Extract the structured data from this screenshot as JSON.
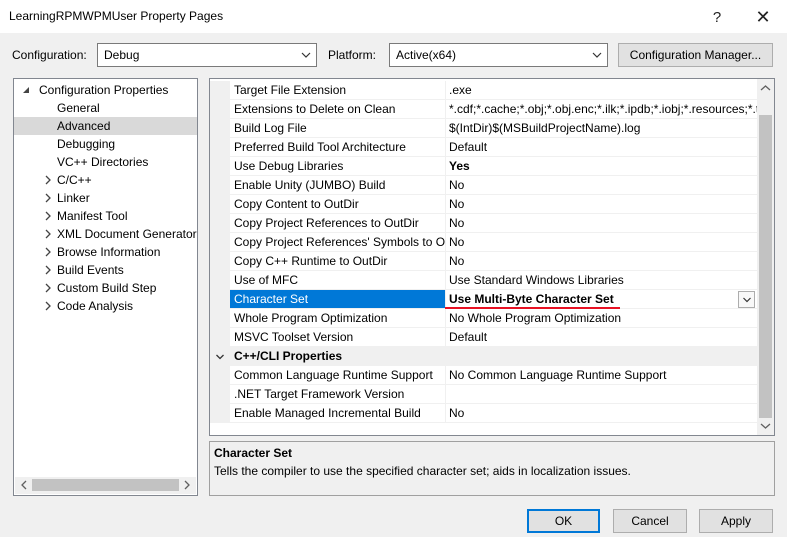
{
  "window": {
    "title": "LearningRPMWPMUser Property Pages",
    "help_glyph": "?",
    "close_glyph": "✕"
  },
  "config_bar": {
    "configuration_label": "Configuration:",
    "configuration_value": "Debug",
    "platform_label": "Platform:",
    "platform_value": "Active(x64)",
    "manager_button": "Configuration Manager..."
  },
  "tree": {
    "root": "Configuration Properties",
    "items": [
      {
        "label": "General",
        "expandable": false
      },
      {
        "label": "Advanced",
        "expandable": false,
        "selected": true
      },
      {
        "label": "Debugging",
        "expandable": false
      },
      {
        "label": "VC++ Directories",
        "expandable": false
      },
      {
        "label": "C/C++",
        "expandable": true
      },
      {
        "label": "Linker",
        "expandable": true
      },
      {
        "label": "Manifest Tool",
        "expandable": true
      },
      {
        "label": "XML Document Generator",
        "expandable": true
      },
      {
        "label": "Browse Information",
        "expandable": true
      },
      {
        "label": "Build Events",
        "expandable": true
      },
      {
        "label": "Custom Build Step",
        "expandable": true
      },
      {
        "label": "Code Analysis",
        "expandable": true
      }
    ]
  },
  "grid": {
    "rows": [
      {
        "name": "Target File Extension",
        "value": ".exe"
      },
      {
        "name": "Extensions to Delete on Clean",
        "value": "*.cdf;*.cache;*.obj;*.obj.enc;*.ilk;*.ipdb;*.iobj;*.resources;*.tlb;*.tli;*.tlh;"
      },
      {
        "name": "Build Log File",
        "value": "$(IntDir)$(MSBuildProjectName).log"
      },
      {
        "name": "Preferred Build Tool Architecture",
        "value": "Default"
      },
      {
        "name": "Use Debug Libraries",
        "value": "Yes",
        "bold": true
      },
      {
        "name": "Enable Unity (JUMBO) Build",
        "value": "No"
      },
      {
        "name": "Copy Content to OutDir",
        "value": "No"
      },
      {
        "name": "Copy Project References to OutDir",
        "value": "No"
      },
      {
        "name": "Copy Project References' Symbols to OutDir",
        "value": "No"
      },
      {
        "name": "Copy C++ Runtime to OutDir",
        "value": "No"
      },
      {
        "name": "Use of MFC",
        "value": "Use Standard Windows Libraries"
      },
      {
        "name": "Character Set",
        "value": "Use Multi-Byte Character Set",
        "bold": true,
        "selected": true
      },
      {
        "name": "Whole Program Optimization",
        "value": "No Whole Program Optimization"
      },
      {
        "name": "MSVC Toolset Version",
        "value": "Default"
      }
    ],
    "category": "C++/CLI Properties",
    "cli_rows": [
      {
        "name": "Common Language Runtime Support",
        "value": "No Common Language Runtime Support"
      },
      {
        "name": ".NET Target Framework Version",
        "value": ""
      },
      {
        "name": "Enable Managed Incremental Build",
        "value": "No"
      }
    ]
  },
  "description": {
    "title": "Character Set",
    "text": "Tells the compiler to use the specified character set; aids in localization issues."
  },
  "buttons": {
    "ok": "OK",
    "cancel": "Cancel",
    "apply": "Apply"
  },
  "colors": {
    "selection": "#0078d7",
    "annotation_underline": "#e81123"
  }
}
